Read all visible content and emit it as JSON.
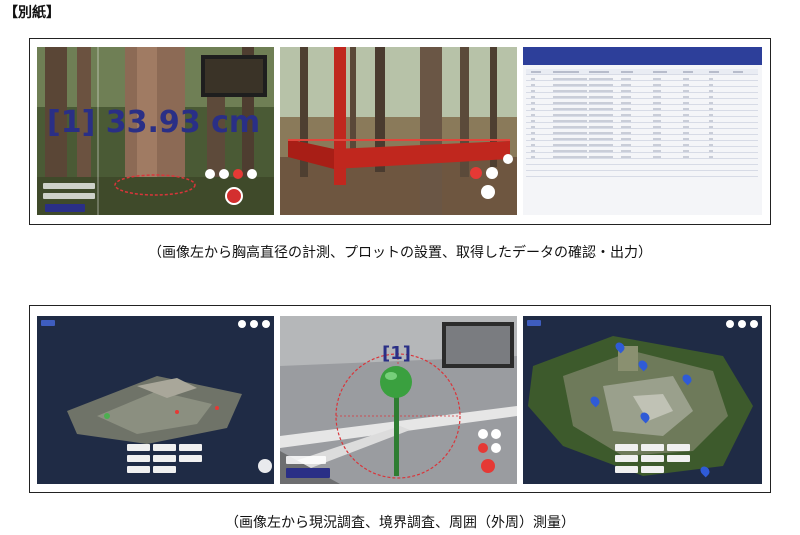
{
  "header": "【別紙】",
  "caption_top": "（画像左から胸高直径の計測、プロットの設置、取得したデータの確認・出力）",
  "caption_bottom": "（画像左から現況調査、境界調査、周囲（外周）測量）",
  "panels": {
    "dbh": {
      "measurement": "[1] 33.93 cm"
    },
    "boundary": {
      "marker_label": "[1]"
    }
  },
  "colors": {
    "overlay_navy": "#2a2f86",
    "plot_red": "#c0271e",
    "app_bg": "#1f2b45"
  },
  "icons": [
    "location-pin-icon"
  ]
}
